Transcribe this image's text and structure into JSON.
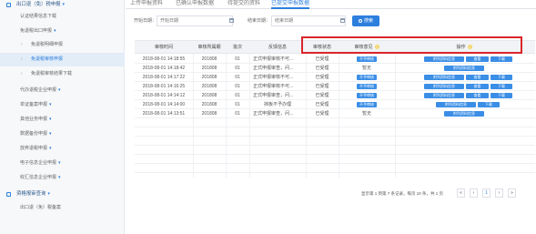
{
  "sidebar": {
    "items": [
      {
        "label": "出口退（免）税申报",
        "level": 1
      },
      {
        "label": "认证结果信息下载",
        "level": 2
      },
      {
        "label": "免退税出口申报",
        "level": 2
      },
      {
        "label": "免退税明细申报",
        "level": 3
      },
      {
        "label": "免退税审核申报",
        "level": 3
      },
      {
        "label": "免退税审核结果下载",
        "level": 3
      },
      {
        "label": "代办退税企业申报",
        "level": 2
      },
      {
        "label": "单证备案申报",
        "level": 2
      },
      {
        "label": "其他业务申报",
        "level": 2
      },
      {
        "label": "数据备份申报",
        "level": 2
      },
      {
        "label": "放弃退税申报",
        "level": 2
      },
      {
        "label": "电子信息企业申报",
        "level": 2
      },
      {
        "label": "收汇信息企业申报",
        "level": 2
      },
      {
        "label": "资格报审查询",
        "level": 1
      },
      {
        "label": "出口退（免）税备案",
        "level": 2
      }
    ]
  },
  "tabs": [
    "上传申报资料",
    "已确认申报数据",
    "待提交的资料",
    "已提交申报数据"
  ],
  "search": {
    "start_label": "开始日期：",
    "start_placeholder": "开始日期",
    "end_label": "结束日期：",
    "end_placeholder": "结束日期",
    "button": "搜索"
  },
  "table": {
    "headers": [
      "审核时间",
      "审核所属期",
      "批次",
      "反馈信息",
      "审核状态",
      "审核意见",
      "操作"
    ],
    "rows": [
      {
        "time": "2018-08-01 14:18:55",
        "period": "201808",
        "batch": "01",
        "feedback": "正式申报审核不可...",
        "status": "已受理",
        "opinion_button": "不予审核",
        "opinion_text": "",
        "ops": [
          "附列资料信息",
          "查看",
          "下载"
        ]
      },
      {
        "time": "2018-08-01 14:18:42",
        "period": "201808",
        "batch": "01",
        "feedback": "正式申报审查，问...",
        "status": "已受理",
        "opinion_button": "",
        "opinion_text": "暂无",
        "ops": [
          "附列资料信息"
        ]
      },
      {
        "time": "2018-08-01 14:17:22",
        "period": "201808",
        "batch": "01",
        "feedback": "正式申报审核不可...",
        "status": "已受理",
        "opinion_button": "不予审核",
        "opinion_text": "",
        "ops": [
          "附列资料信息",
          "查看",
          "下载"
        ]
      },
      {
        "time": "2018-08-01 14:16:25",
        "period": "201808",
        "batch": "01",
        "feedback": "正式申报审核不可...",
        "status": "已受理",
        "opinion_button": "不予审核",
        "opinion_text": "",
        "ops": [
          "附列资料信息",
          "查看",
          "下载"
        ]
      },
      {
        "time": "2018-08-01 14:14:12",
        "period": "201808",
        "batch": "01",
        "feedback": "正式申报审查，问...",
        "status": "已受理",
        "opinion_button": "不予审核",
        "opinion_text": "",
        "ops": [
          "附列资料信息",
          "查看",
          "下载"
        ]
      },
      {
        "time": "2018-08-01 14:14:00",
        "period": "201808",
        "batch": "01",
        "feedback": "挡板不予办理",
        "status": "已受理",
        "opinion_button": "不予审核",
        "opinion_text": "",
        "ops": [
          "附列资料信息",
          "下载"
        ]
      },
      {
        "time": "2018-08-01 14:13:51",
        "period": "201808",
        "batch": "01",
        "feedback": "正式申报审查，问...",
        "status": "已受理",
        "opinion_button": "",
        "opinion_text": "暂无",
        "ops": [
          "附列资料信息"
        ]
      }
    ]
  },
  "pagination": {
    "summary": "显示第 1 到第 7 条记录，每页 10 条，共 1 页",
    "buttons": [
      "«",
      "‹",
      "1",
      "›",
      "»"
    ]
  },
  "colors": {
    "accent": "#2d7fdd",
    "highlight_border": "#d9262b"
  }
}
